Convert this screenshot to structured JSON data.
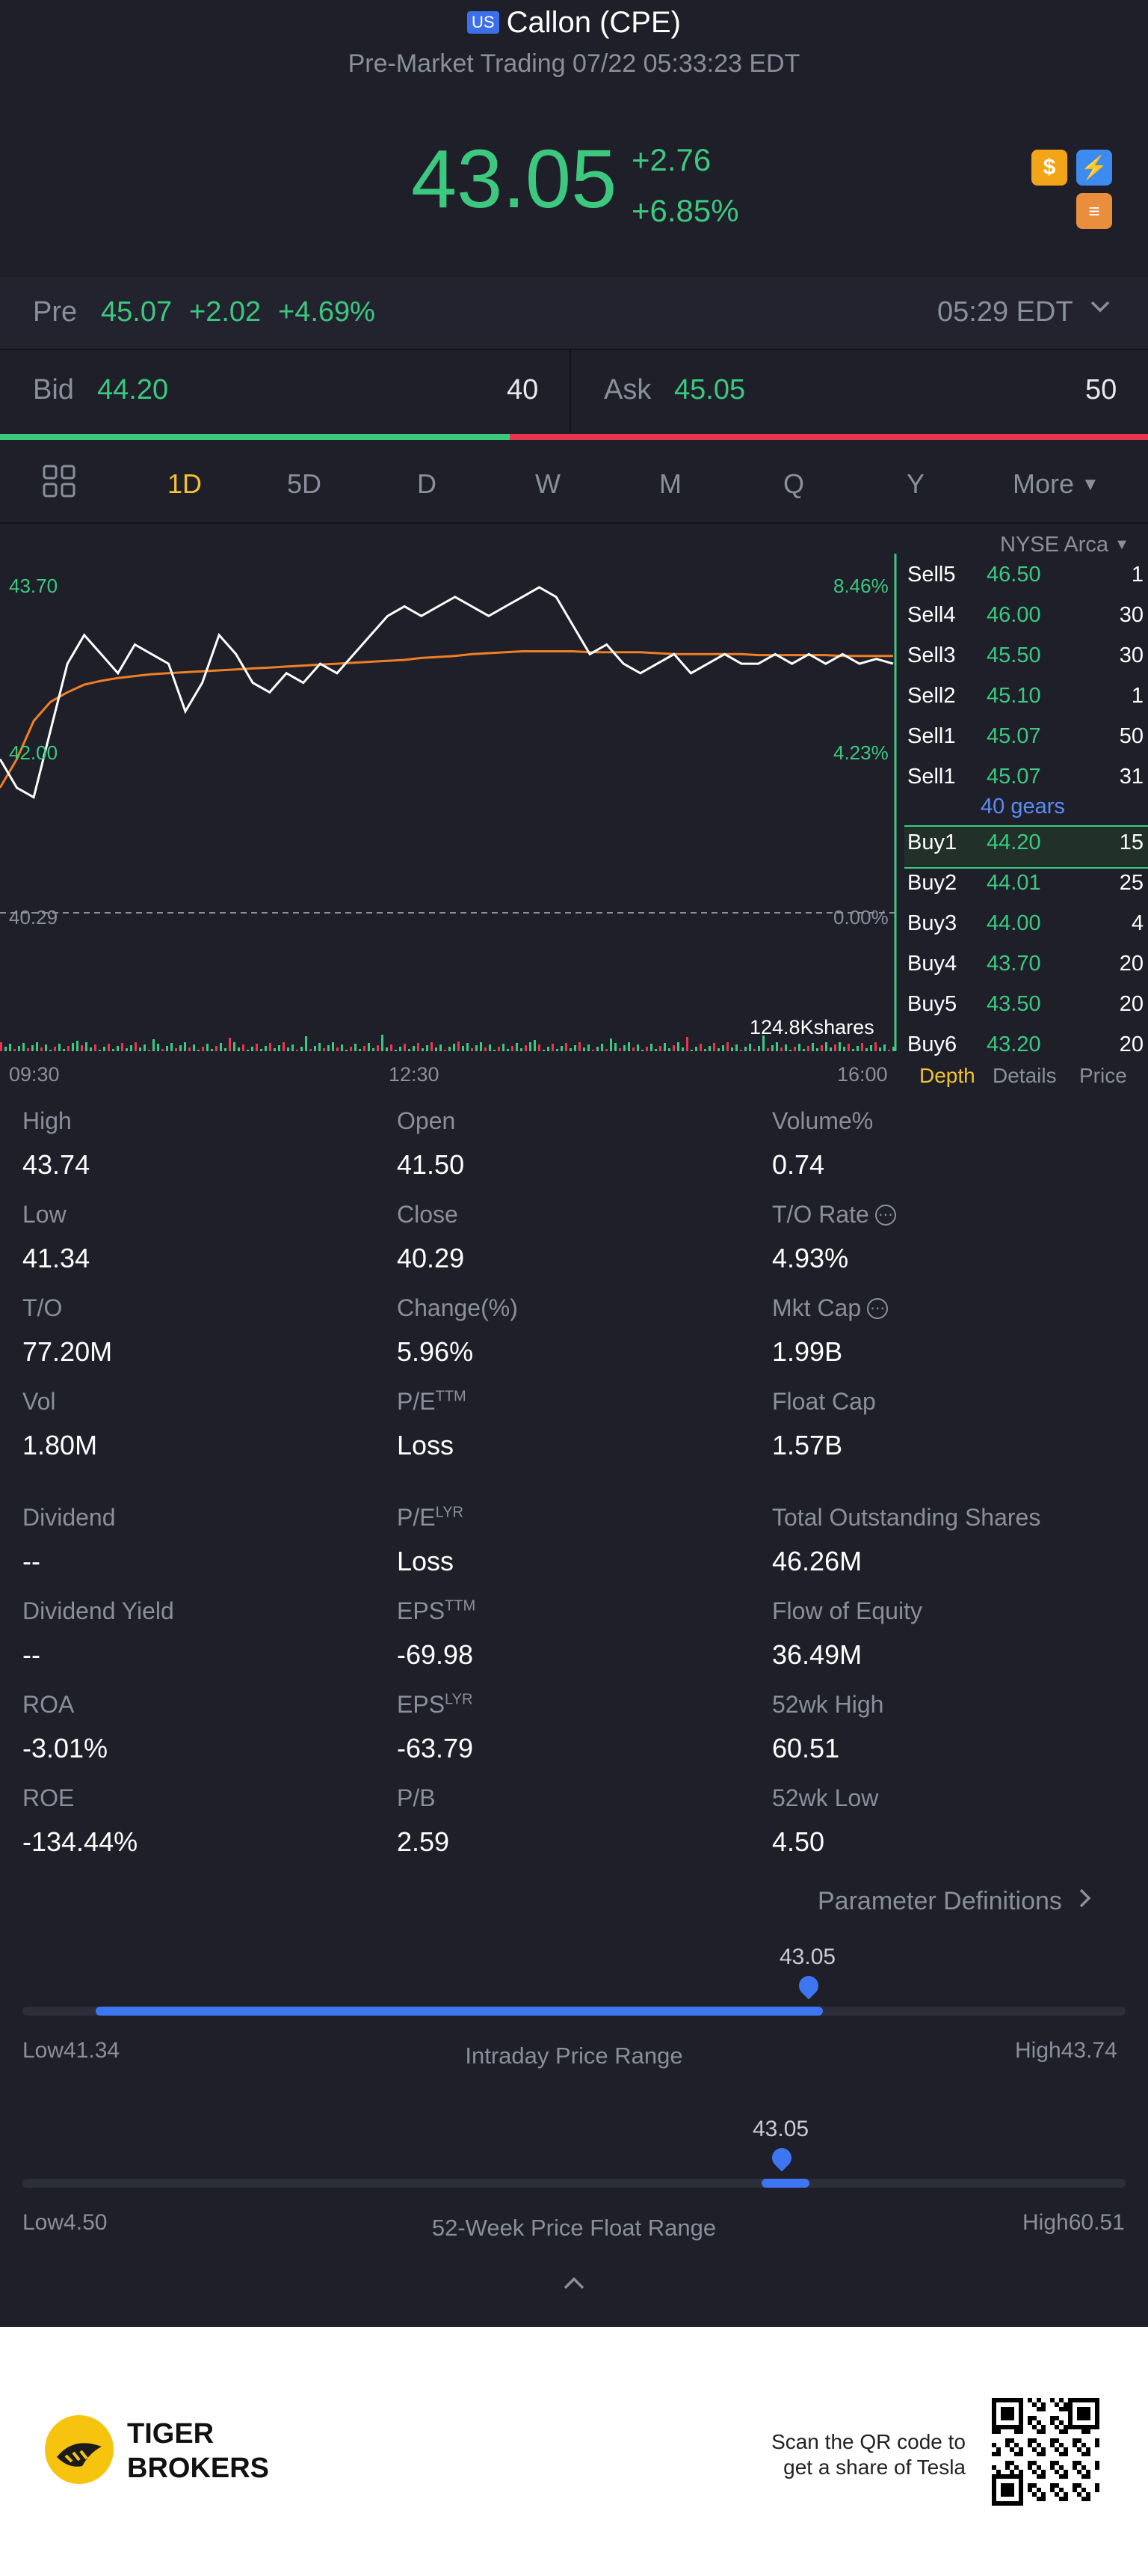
{
  "header": {
    "market_badge": "US",
    "title": "Callon (CPE)",
    "subtitle": "Pre-Market Trading 07/22 05:33:23 EDT",
    "price": "43.05",
    "change": "+2.76",
    "change_pct": "+6.85%"
  },
  "pre": {
    "label": "Pre",
    "price": "45.07",
    "change": "+2.02",
    "change_pct": "+4.69%",
    "time": "05:29 EDT"
  },
  "bid_ask": {
    "bid_label": "Bid",
    "bid_price": "44.20",
    "bid_size": "40",
    "ask_label": "Ask",
    "ask_price": "45.05",
    "ask_size": "50"
  },
  "tabs": [
    "1D",
    "5D",
    "D",
    "W",
    "M",
    "Q",
    "Y",
    "More"
  ],
  "active_tab": "1D",
  "chart_data": {
    "type": "line",
    "x_ticks": [
      "09:30",
      "12:30",
      "16:00"
    ],
    "y_left_labels": [
      "43.70",
      "42.00",
      "40.29"
    ],
    "y_right_labels": [
      "8.46%",
      "4.23%",
      "0.00%"
    ],
    "volume_label": "124.8Kshares",
    "ylim": [
      40.29,
      43.7
    ],
    "series": [
      {
        "name": "price",
        "color": "#ffffff",
        "values": [
          41.9,
          41.6,
          41.5,
          42.2,
          42.9,
          43.2,
          43.0,
          42.8,
          43.1,
          43.0,
          42.9,
          42.4,
          42.7,
          43.2,
          43.0,
          42.7,
          42.6,
          42.8,
          42.7,
          42.9,
          42.8,
          43.0,
          43.2,
          43.4,
          43.5,
          43.4,
          43.5,
          43.6,
          43.5,
          43.4,
          43.5,
          43.6,
          43.7,
          43.6,
          43.3,
          43.0,
          43.1,
          42.9,
          42.8,
          42.9,
          43.0,
          42.8,
          42.9,
          43.0,
          42.9,
          42.9,
          43.0,
          42.9,
          43.0,
          42.9,
          43.0,
          42.9,
          42.95,
          42.9
        ]
      },
      {
        "name": "avg",
        "color": "#f07f23",
        "values": [
          41.6,
          41.9,
          42.3,
          42.5,
          42.6,
          42.68,
          42.72,
          42.75,
          42.77,
          42.79,
          42.8,
          42.81,
          42.82,
          42.83,
          42.84,
          42.85,
          42.86,
          42.87,
          42.88,
          42.89,
          42.9,
          42.91,
          42.92,
          42.93,
          42.94,
          42.96,
          42.97,
          42.98,
          43.0,
          43.01,
          43.02,
          43.03,
          43.03,
          43.03,
          43.03,
          43.02,
          43.02,
          43.02,
          43.02,
          43.01,
          43.0,
          43.0,
          43.0,
          43.0,
          43.0,
          42.99,
          42.99,
          42.99,
          42.99,
          42.99,
          42.98,
          42.98,
          42.98,
          42.98
        ]
      }
    ]
  },
  "order_book": {
    "exchange": "NYSE Arca",
    "sells": [
      {
        "label": "Sell5",
        "price": "46.50",
        "size": "1"
      },
      {
        "label": "Sell4",
        "price": "46.00",
        "size": "30"
      },
      {
        "label": "Sell3",
        "price": "45.50",
        "size": "30"
      },
      {
        "label": "Sell2",
        "price": "45.10",
        "size": "1"
      },
      {
        "label": "Sell1",
        "price": "45.07",
        "size": "50"
      },
      {
        "label": "Sell1",
        "price": "45.07",
        "size": "31"
      }
    ],
    "gears": "40 gears",
    "buys": [
      {
        "label": "Buy1",
        "price": "44.20",
        "size": "15"
      },
      {
        "label": "Buy2",
        "price": "44.01",
        "size": "25"
      },
      {
        "label": "Buy3",
        "price": "44.00",
        "size": "4"
      },
      {
        "label": "Buy4",
        "price": "43.70",
        "size": "20"
      },
      {
        "label": "Buy5",
        "price": "43.50",
        "size": "20"
      },
      {
        "label": "Buy6",
        "price": "43.20",
        "size": "20"
      }
    ],
    "tabs": [
      "Depth",
      "Details",
      "Price"
    ]
  },
  "stats": [
    [
      {
        "label": "High",
        "value": "43.74"
      },
      {
        "label": "Open",
        "value": "41.50"
      },
      {
        "label": "Volume%",
        "value": "0.74"
      }
    ],
    [
      {
        "label": "Low",
        "value": "41.34"
      },
      {
        "label": "Close",
        "value": "40.29"
      },
      {
        "label": "T/O Rate",
        "value": "4.93%"
      }
    ],
    [
      {
        "label": "T/O",
        "value": "77.20M"
      },
      {
        "label": "Change(%)",
        "value": "5.96%"
      },
      {
        "label": "Mkt Cap",
        "value": "1.99B"
      }
    ],
    [
      {
        "label": "Vol",
        "value": "1.80M"
      },
      {
        "label": "P/E",
        "sup": "TTM",
        "value": "Loss"
      },
      {
        "label": "Float Cap",
        "value": "1.57B"
      }
    ],
    [
      {
        "label": "Dividend",
        "value": "--"
      },
      {
        "label": "P/E",
        "sup": "LYR",
        "value": "Loss"
      },
      {
        "label": "Total Outstanding Shares",
        "value": "46.26M"
      }
    ],
    [
      {
        "label": "Dividend Yield",
        "value": "--"
      },
      {
        "label": "EPS",
        "sup": "TTM",
        "value": "-69.98"
      },
      {
        "label": "Flow of Equity",
        "value": "36.49M"
      }
    ],
    [
      {
        "label": "ROA",
        "value": "-3.01%"
      },
      {
        "label": "EPS",
        "sup": "LYR",
        "value": "-63.79"
      },
      {
        "label": "52wk High",
        "value": "60.51"
      }
    ],
    [
      {
        "label": "ROE",
        "value": "-134.44%"
      },
      {
        "label": "P/B",
        "value": "2.59"
      },
      {
        "label": "52wk Low",
        "value": "4.50"
      }
    ]
  ],
  "param_link": "Parameter Definitions",
  "intraday": {
    "current": "43.05",
    "low_label": "Low",
    "low": "41.34",
    "high_label": "High",
    "high": "43.74",
    "title": "Intraday Price Range",
    "fill_start": 0.0,
    "fill_end": 0.71
  },
  "week52": {
    "current": "43.05",
    "low_label": "Low",
    "low": "4.50",
    "high_label": "High",
    "high": "60.51",
    "title": "52-Week Price Float Range",
    "marker": 0.685
  },
  "footer": {
    "brand_line1": "TIGER",
    "brand_line2": "BROKERS",
    "qr_text_line1": "Scan the QR code to",
    "qr_text_line2": "get a share of Tesla"
  },
  "colors": {
    "up": "#3cc97f",
    "down": "#e8374d",
    "accent": "#3d76f0",
    "active_tab": "#f2c230",
    "avg_line": "#f07f23"
  }
}
